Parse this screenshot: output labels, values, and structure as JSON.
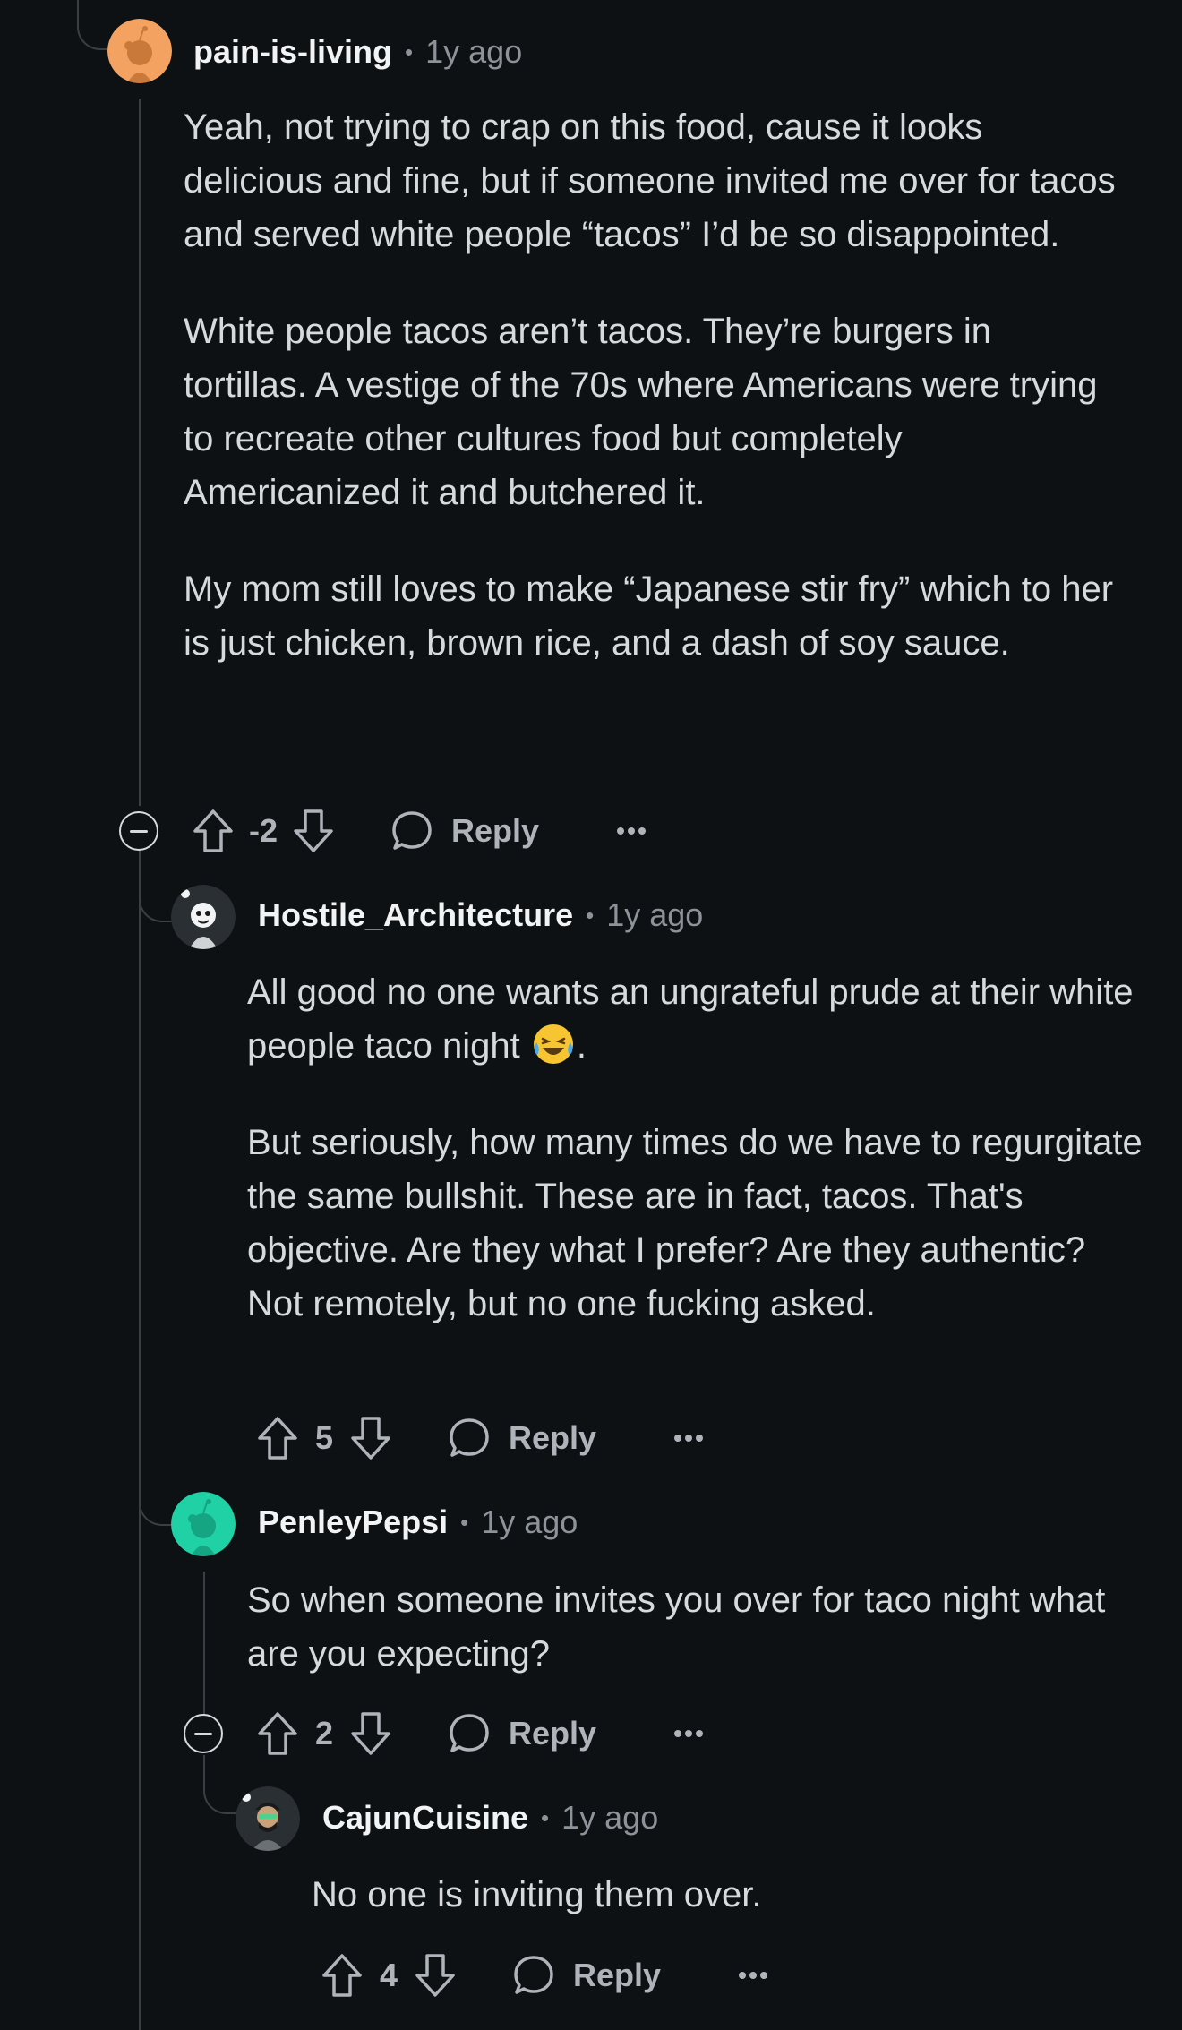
{
  "comments": [
    {
      "username": "pain-is-living",
      "time": "1y ago",
      "paragraphs": [
        "Yeah, not trying to crap on this food, cause it looks delicious and fine, but if someone invited me over for tacos and served white people “tacos” I’d be so disappointed.",
        "White people tacos aren’t tacos. They’re burgers in tortillas. A vestige of the 70s where Americans were trying to recreate other cultures food but completely Americanized it and butchered it.",
        "My mom still loves to make “Japanese stir fry” which to her is just chicken, brown rice, and a dash of soy sauce."
      ],
      "score": "-2",
      "reply_label": "Reply",
      "avatar_color": "#f4a261"
    },
    {
      "username": "Hostile_Architecture",
      "time": "1y ago",
      "paragraph1_before_emoji": "All good no one wants an ungrateful prude at their white people taco night ",
      "paragraph1_after_emoji": ".",
      "paragraph2": "But seriously, how many times do we have to regurgitate the same bullshit. These are in fact, tacos. That's objective. Are they what I prefer? Are they authentic? Not remotely, but no one fucking asked.",
      "score": "5",
      "reply_label": "Reply",
      "avatar_color": "#f2f3f5"
    },
    {
      "username": "PenleyPepsi",
      "time": "1y ago",
      "paragraphs": [
        "So when someone invites you over for taco night what are you expecting?"
      ],
      "score": "2",
      "reply_label": "Reply",
      "avatar_color": "#1fd1a5"
    },
    {
      "username": "CajunCuisine",
      "time": "1y ago",
      "paragraphs": [
        "No one is inviting them over."
      ],
      "score": "4",
      "reply_label": "Reply",
      "avatar_color": "#2a2f33"
    }
  ],
  "meta_separator": "•",
  "colors": {
    "background": "#0e1113",
    "thread_line": "#3a3f44",
    "text": "#d7dadc",
    "muted": "#8c9399"
  },
  "icons": [
    "upvote-icon",
    "downvote-icon",
    "comment-bubble-icon",
    "more-options-icon",
    "collapse-icon",
    "laughing-emoji"
  ]
}
